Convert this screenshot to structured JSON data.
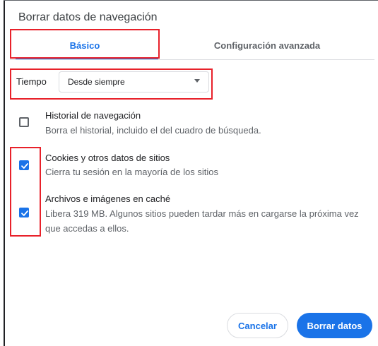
{
  "dialog": {
    "title": "Borrar datos de navegación"
  },
  "tabs": [
    {
      "label": "Básico",
      "selected": true
    },
    {
      "label": "Configuración avanzada",
      "selected": false
    }
  ],
  "time_range": {
    "label": "Tiempo",
    "selected": "Desde siempre"
  },
  "items": [
    {
      "title": "Historial de navegación",
      "description": "Borra el historial, incluido el del cuadro de búsqueda.",
      "checked": false
    },
    {
      "title": "Cookies y otros datos de sitios",
      "description": "Cierra tu sesión en la mayoría de los sitios",
      "checked": true
    },
    {
      "title": "Archivos e imágenes en caché",
      "description_line1": "Libera 319 MB. Algunos sitios pueden tardar más en cargarse la próxima vez",
      "description_line2": "que accedas a ellos.",
      "checked": true
    }
  ],
  "buttons": {
    "cancel": "Cancelar",
    "clear": "Borrar datos"
  },
  "colors": {
    "accent": "#1a73e8",
    "highlight": "#e8212a"
  }
}
